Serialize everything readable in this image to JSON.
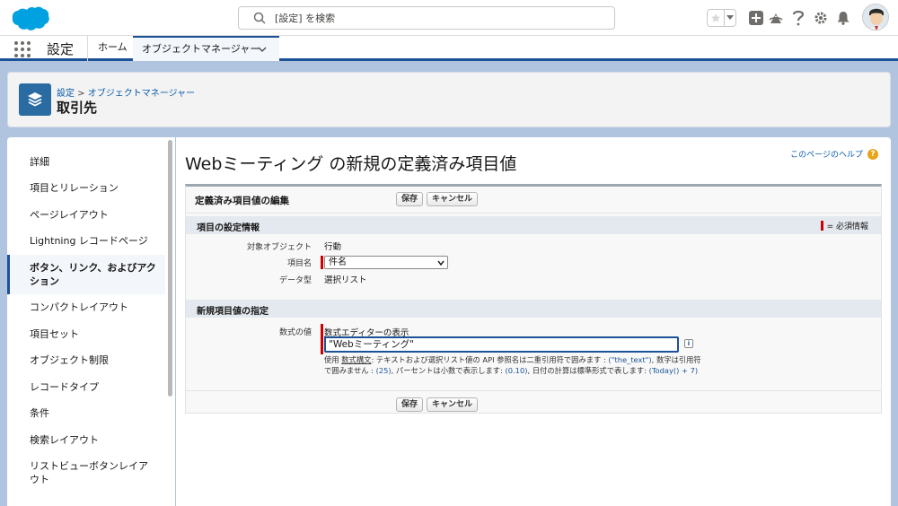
{
  "header": {
    "search_placeholder": "[設定] を検索"
  },
  "nav": {
    "app_name": "設定",
    "home": "ホーム",
    "object_manager": "オブジェクトマネージャー"
  },
  "page_header": {
    "breadcrumb_setup": "設定",
    "breadcrumb_sep": " > ",
    "breadcrumb_om": "オブジェクトマネージャー",
    "title": "取引先"
  },
  "sidebar": {
    "items": [
      {
        "label": "詳細"
      },
      {
        "label": "項目とリレーション"
      },
      {
        "label": "ページレイアウト"
      },
      {
        "label": "Lightning レコードページ"
      },
      {
        "label": "ボタン、リンク、およびアクション"
      },
      {
        "label": "コンパクトレイアウト"
      },
      {
        "label": "項目セット"
      },
      {
        "label": "オブジェクト制限"
      },
      {
        "label": "レコードタイプ"
      },
      {
        "label": "条件"
      },
      {
        "label": "検索レイアウト"
      },
      {
        "label": "リストビューボタンレイアウト"
      }
    ]
  },
  "main": {
    "title": "Webミーティング の新規の定義済み項目値",
    "help_link": "このページのヘルプ",
    "panel_title": "定義済み項目値の編集",
    "save": "保存",
    "cancel": "キャンセル",
    "section1": "項目の設定情報",
    "required_legend": "= 必須情報",
    "target_object_label": "対象オブジェクト",
    "target_object_value": "行動",
    "field_name_label": "項目名",
    "field_name_value": "件名",
    "data_type_label": "データ型",
    "data_type_value": "選択リスト",
    "section2": "新規項目値の指定",
    "formula_label": "数式の値",
    "formula_editor_link": "数式エディターの表示",
    "formula_value": "\"Webミーティング\"",
    "help_use": "使用 ",
    "help_syntax": "数式構文",
    "help_t1": ": テキストおよび選択リスト値の API 参照名は二重引用符で囲みます : ",
    "help_ex1": "(\"the_text\")",
    "help_t2": ", 数字は引用符で囲みません : ",
    "help_ex2": "(25)",
    "help_t3": ", パーセントは小数で表示します: ",
    "help_ex3": "(0.10)",
    "help_t4": ", 日付の計算は標準形式で表します: ",
    "help_ex4": "(Today() + 7)"
  }
}
